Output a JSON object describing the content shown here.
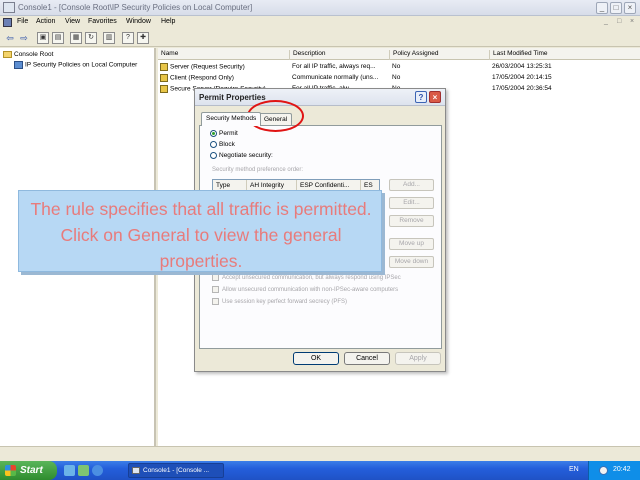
{
  "window": {
    "title": "Console1 - [Console Root\\IP Security Policies on Local Computer]",
    "minimize": "_",
    "maximize": "□",
    "close": "×"
  },
  "menubar": {
    "items": [
      "File",
      "Action",
      "View",
      "Favorites",
      "Window",
      "Help"
    ],
    "doc_controls": [
      "_",
      "□",
      "×"
    ]
  },
  "toolbar": {
    "icons": [
      "back-icon",
      "forward-icon",
      "up-folder-icon",
      "show-hide-tree-icon",
      "properties-icon",
      "refresh-icon",
      "export-list-icon",
      "help-icon",
      "add-policy-icon"
    ]
  },
  "tree": {
    "root": "Console Root",
    "child": "IP Security Policies on Local Computer"
  },
  "list": {
    "columns": [
      "Name",
      "Description",
      "Policy Assigned",
      "Last Modified Time"
    ],
    "rows": [
      {
        "name": "Server (Request Security)",
        "description": "For all IP traffic, always req...",
        "assigned": "No",
        "modified": "26/03/2004 13:25:31"
      },
      {
        "name": "Client (Respond Only)",
        "description": "Communicate normally (uns...",
        "assigned": "No",
        "modified": "17/05/2004 20:14:15"
      },
      {
        "name": "Secure Server (Require Security)",
        "description": "For all IP traffic, alw...",
        "assigned": "No",
        "modified": "17/05/2004 20:36:54"
      }
    ]
  },
  "dialog": {
    "title": "Permit Properties",
    "help": "?",
    "close": "×",
    "tabs": [
      "Security Methods",
      "General"
    ],
    "radios": [
      {
        "label": "Permit",
        "checked": true
      },
      {
        "label": "Block",
        "checked": false
      },
      {
        "label": "Negotiate security:",
        "checked": false
      }
    ],
    "order_label": "Security method preference order:",
    "table_columns": [
      "Type",
      "AH Integrity",
      "ESP Confidenti...",
      "ES"
    ],
    "side_buttons": [
      "Add...",
      "Edit...",
      "Remove",
      "Move up",
      "Move down"
    ],
    "checkboxes": [
      "Accept unsecured communication, but always respond using IPSec",
      "Allow unsecured communication with non-IPSec-aware computers",
      "Use session key perfect forward secrecy (PFS)"
    ],
    "buttons": {
      "ok": "OK",
      "cancel": "Cancel",
      "apply": "Apply"
    }
  },
  "callout": {
    "text": "The rule specifies that all traffic is permitted. Click on General to view the general properties."
  },
  "taskbar": {
    "start": "Start",
    "task": "Console1 - [Console ...",
    "lang": "EN",
    "clock": "20:42"
  },
  "colors": {
    "callout_bg": "#b7d8f4",
    "callout_text": "#e87b7b",
    "highlight_circle": "#e01414",
    "taskbar": "#245edb"
  }
}
